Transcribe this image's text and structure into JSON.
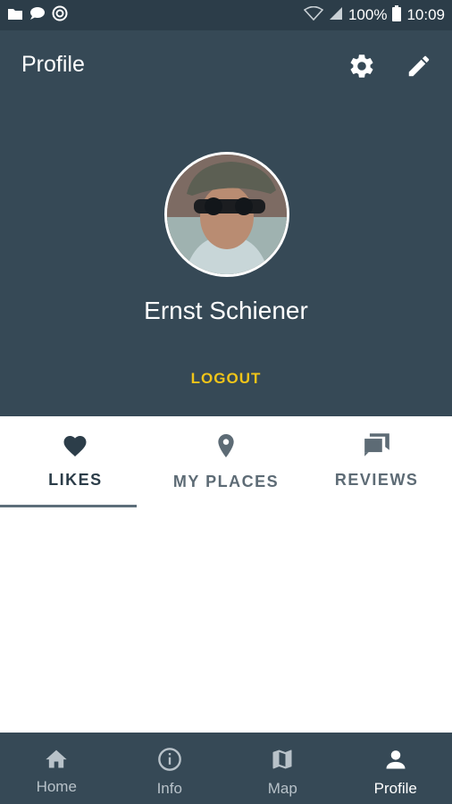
{
  "status_bar": {
    "battery": "100%",
    "time": "10:09",
    "left_icons": [
      "folder-icon",
      "chat-icon",
      "target-icon"
    ],
    "right_icons": [
      "wifi-icon",
      "signal-icon",
      "battery-icon"
    ]
  },
  "header": {
    "title": "Profile",
    "actions": [
      "settings-icon",
      "edit-icon"
    ]
  },
  "profile": {
    "name": "Ernst Schiener",
    "logout_label": "LOGOUT"
  },
  "tabs": [
    {
      "label": "LIKES",
      "icon": "heart-icon",
      "active": true
    },
    {
      "label": "MY PLACES",
      "icon": "location-pin-icon",
      "active": false
    },
    {
      "label": "REVIEWS",
      "icon": "reviews-icon",
      "active": false
    }
  ],
  "bottom_nav": [
    {
      "label": "Home",
      "icon": "home-icon",
      "active": false
    },
    {
      "label": "Info",
      "icon": "info-icon",
      "active": false
    },
    {
      "label": "Map",
      "icon": "map-icon",
      "active": false
    },
    {
      "label": "Profile",
      "icon": "person-icon",
      "active": true
    }
  ],
  "colors": {
    "primary": "#364956",
    "status_bar": "#2c3d49",
    "accent": "#f0c419",
    "tab_indicator": "#5d6e7a"
  }
}
